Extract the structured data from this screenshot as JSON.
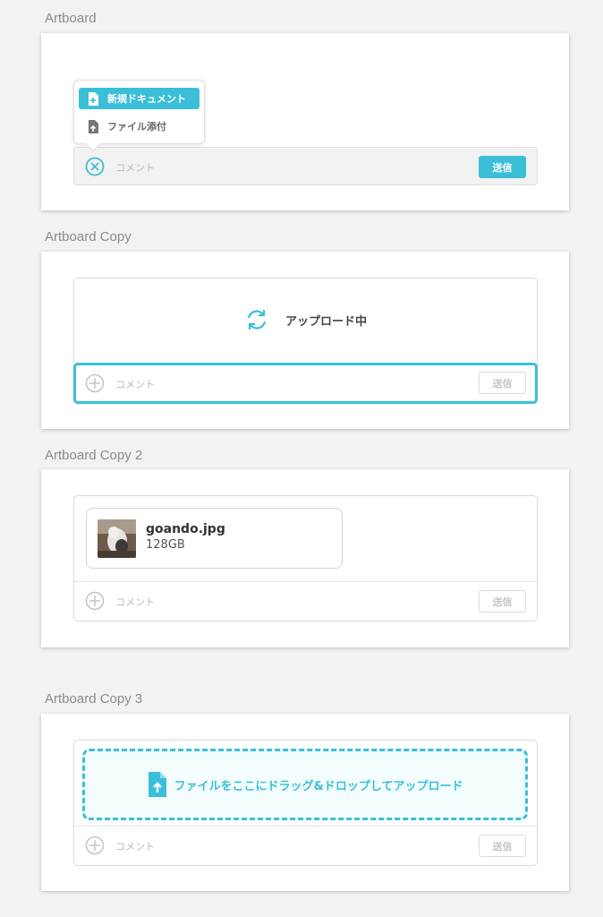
{
  "artboards": [
    {
      "title": "Artboard"
    },
    {
      "title": "Artboard Copy"
    },
    {
      "title": "Artboard Copy 2"
    },
    {
      "title": "Artboard Copy 3"
    }
  ],
  "menu": {
    "new_document": "新規ドキュメント",
    "attach_file": "ファイル添付"
  },
  "composer": {
    "placeholder": "コメント",
    "send_label": "送信"
  },
  "upload": {
    "status": "アップロード中"
  },
  "attachment": {
    "name": "goando.jpg",
    "size": "128GB"
  },
  "dropzone": {
    "text": "ファイルをここにドラッグ&ドロップしてアップロード"
  },
  "colors": {
    "accent": "#3bbfd8",
    "background": "#f2f2f2",
    "placeholder": "#b8b8b8"
  },
  "icons": [
    "close-circle-icon",
    "plus-circle-icon",
    "new-document-icon",
    "file-upload-icon",
    "sync-icon"
  ]
}
